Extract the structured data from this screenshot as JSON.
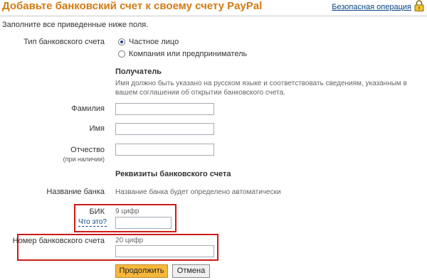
{
  "header": {
    "title": "Добавьте банковский счет к своему счету PayPal",
    "secure_link": "Безопасная операция",
    "lock_icon": "padlock-icon"
  },
  "intro": "Заполните все приведенные ниже поля.",
  "account_type": {
    "label": "Тип банковского счета",
    "options": [
      "Частное лицо",
      "Компания или предприниматель"
    ],
    "selected": "Частное лицо"
  },
  "recipient": {
    "heading": "Получатель",
    "note": "Имя должно быть указано на русском языке и соответствовать сведениям, указанным в вашем соглашении об открытии банковского счета.",
    "last_name_label": "Фамилия",
    "last_name_value": "",
    "first_name_label": "Имя",
    "first_name_value": "",
    "patronymic_label": "Отчество",
    "patronymic_sub": "(при наличии)",
    "patronymic_value": ""
  },
  "bank": {
    "heading": "Реквизиты банковского счета",
    "name_label": "Название банка",
    "name_value": "Название банка будет определено автоматически",
    "bik_label": "БИК",
    "bik_help": "Что это?",
    "bik_hint": "9 цифр",
    "bik_value": "",
    "account_label": "Номер банковского счета",
    "account_hint": "20 цифр",
    "account_value": ""
  },
  "buttons": {
    "continue": "Продолжить",
    "cancel": "Отмена"
  },
  "colors": {
    "title": "#d27a14",
    "link": "#084482",
    "highlight": "#cc1a1a",
    "primary_button": "#f6b73c"
  }
}
